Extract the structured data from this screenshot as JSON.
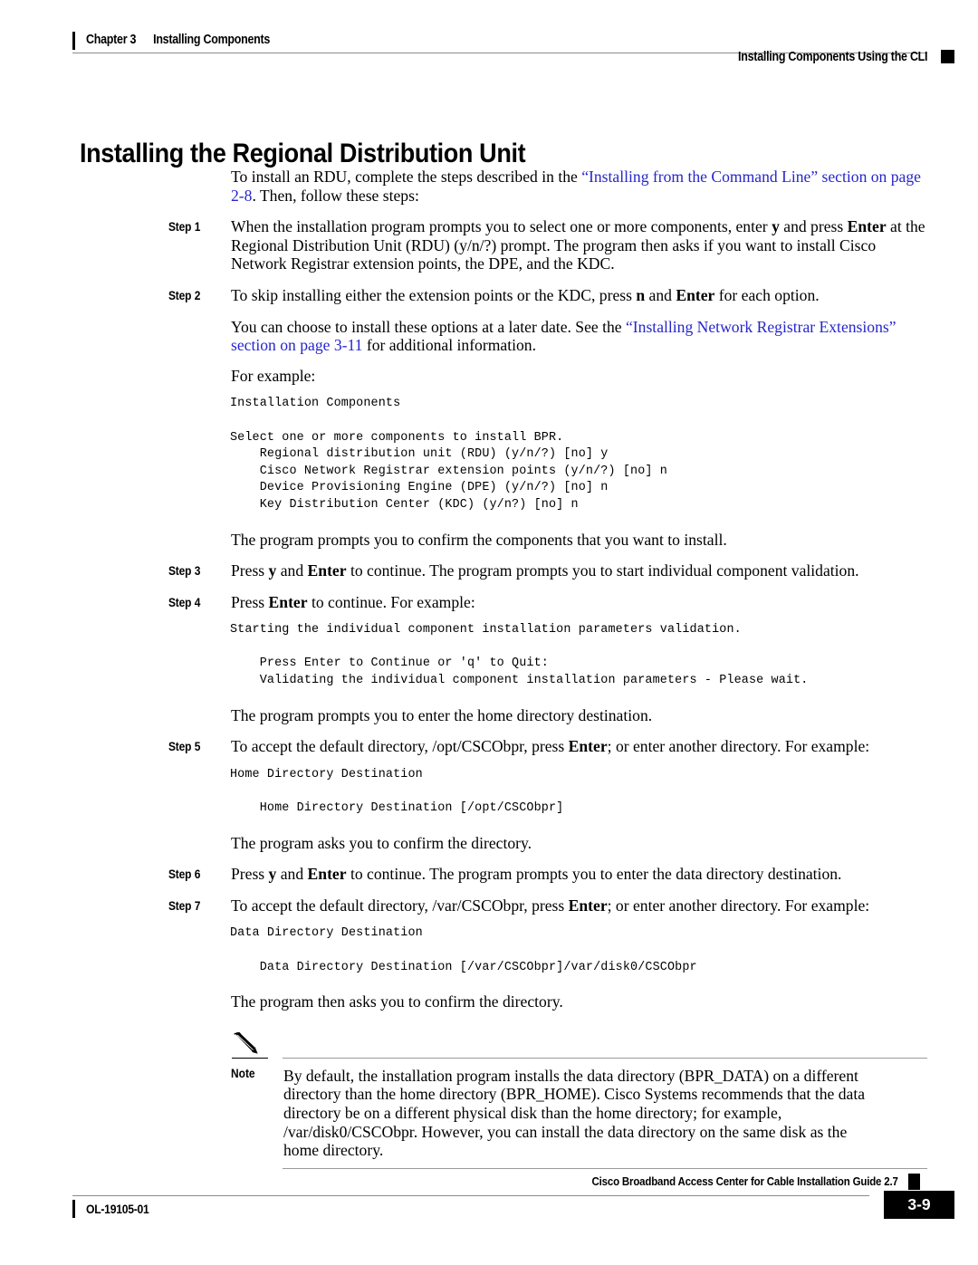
{
  "header": {
    "chapter": "Chapter 3",
    "chapter_title": "Installing Components",
    "running_head_right": "Installing Components Using the CLI"
  },
  "title": "Installing the Regional Distribution Unit",
  "intro": {
    "text_before_link": "To install an RDU, complete the steps described in the ",
    "link_part1": "“Installing from the Command Line” section on page 2-8",
    "text_after_link": ". Then, follow these steps:"
  },
  "steps": [
    {
      "label": "Step",
      "number": "1",
      "segments": [
        {
          "t": "When the installation program prompts you to select one or more components, enter ",
          "s": "normal"
        },
        {
          "t": "y",
          "s": "bold"
        },
        {
          "t": " and press ",
          "s": "normal"
        },
        {
          "t": "Enter",
          "s": "bold"
        },
        {
          "t": " at the Regional Distribution Unit (RDU) (y/n/?) prompt. The program then asks if you want to install Cisco Network Registrar extension points, the DPE, and the KDC.",
          "s": "normal"
        }
      ]
    },
    {
      "label": "Step",
      "number": "2",
      "segments": [
        {
          "t": "To skip installing either the extension points or the KDC, press ",
          "s": "normal"
        },
        {
          "t": "n",
          "s": "bold"
        },
        {
          "t": " and ",
          "s": "normal"
        },
        {
          "t": "Enter",
          "s": "bold"
        },
        {
          "t": " for each option.",
          "s": "normal"
        }
      ]
    },
    {
      "label": "Step",
      "number": "3",
      "segments": [
        {
          "t": "Press ",
          "s": "normal"
        },
        {
          "t": "y",
          "s": "bold"
        },
        {
          "t": " and ",
          "s": "normal"
        },
        {
          "t": "Enter",
          "s": "bold"
        },
        {
          "t": " to continue. The program prompts you to start individual component validation.",
          "s": "normal"
        }
      ]
    },
    {
      "label": "Step",
      "number": "4",
      "segments": [
        {
          "t": "Press ",
          "s": "normal"
        },
        {
          "t": "Enter",
          "s": "bold"
        },
        {
          "t": " to continue. For example:",
          "s": "normal"
        }
      ]
    },
    {
      "label": "Step",
      "number": "5",
      "segments": [
        {
          "t": "To accept the default directory, /opt/CSCObpr, press ",
          "s": "normal"
        },
        {
          "t": "Enter",
          "s": "bold"
        },
        {
          "t": "; or enter another directory. For example:",
          "s": "normal"
        }
      ]
    },
    {
      "label": "Step",
      "number": "6",
      "segments": [
        {
          "t": "Press ",
          "s": "normal"
        },
        {
          "t": "y",
          "s": "bold"
        },
        {
          "t": " and ",
          "s": "normal"
        },
        {
          "t": "Enter",
          "s": "bold"
        },
        {
          "t": " to continue. The program prompts you to enter the data directory destination.",
          "s": "normal"
        }
      ]
    },
    {
      "label": "Step",
      "number": "7",
      "segments": [
        {
          "t": "To accept the default directory, /var/CSCObpr, press ",
          "s": "normal"
        },
        {
          "t": "Enter",
          "s": "bold"
        },
        {
          "t": "; or enter another directory. For example:",
          "s": "normal"
        }
      ]
    }
  ],
  "paragraphs": {
    "after_step2_a_before": "You can choose to install these options at a later date. See the ",
    "after_step2_a_link": "“Installing Network Registrar Extensions” section on page 3-11",
    "after_step2_a_after": " for additional information.",
    "for_example": "For example:",
    "confirm_components": "The program prompts you to confirm the components that you want to install.",
    "home_dir_prompt": "The program prompts you to enter the home directory destination.",
    "confirm_directory": "The program asks you to confirm the directory.",
    "confirm_directory_then": "The program then asks you to confirm the directory."
  },
  "code_blocks": {
    "components": "Installation Components\n\nSelect one or more components to install BPR.\n    Regional distribution unit (RDU) (y/n/?) [no] y\n    Cisco Network Registrar extension points (y/n/?) [no] n\n    Device Provisioning Engine (DPE) (y/n/?) [no] n\n    Key Distribution Center (KDC) (y/n?) [no] n",
    "validation": "Starting the individual component installation parameters validation.\n\n    Press Enter to Continue or 'q' to Quit:\n    Validating the individual component installation parameters - Please wait.",
    "home_directory": "Home Directory Destination\n\n    Home Directory Destination [/opt/CSCObpr]",
    "data_directory": "Data Directory Destination\n\n    Data Directory Destination [/var/CSCObpr]/var/disk0/CSCObpr"
  },
  "note": {
    "label": "Note",
    "body": "By default, the installation program installs the data directory (BPR_DATA) on a different directory than the home directory (BPR_HOME). Cisco Systems recommends that the data directory be on a different physical disk than the home directory; for example, /var/disk0/CSCObpr. However, you can install the data directory on the same disk as the home directory."
  },
  "footer": {
    "guide_title": "Cisco Broadband Access Center for Cable Installation Guide 2.7",
    "doc_id": "OL-19105-01",
    "page_number": "3-9"
  },
  "colors": {
    "link": "#2626CC",
    "rule": "#8a8a8a",
    "accent_black": "#000000"
  }
}
